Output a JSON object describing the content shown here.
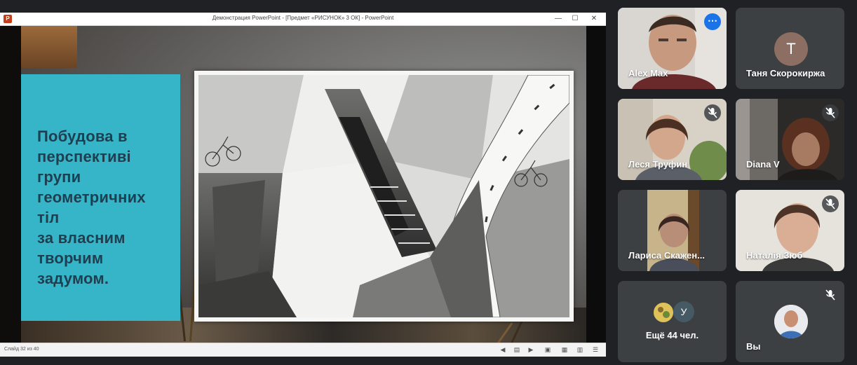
{
  "presentation": {
    "window_title": "Демонстрация PowerPoint - [Предмет «РИСУНОК» 3 ОК] - PowerPoint",
    "app_icon_letter": "P",
    "controls": {
      "minimize": "—",
      "maximize": "☐",
      "close": "✕"
    },
    "slide_text": "Побудова в\nперспективі\nгрупи\nгеометричних\nтіл\nза власним\nтворчим\nзадумом.",
    "status": {
      "slide_counter": "Слайд 32 из 40"
    }
  },
  "participants": [
    {
      "name": "Alex Max",
      "type": "video",
      "active": true,
      "more_icon": "⋯"
    },
    {
      "name": "Таня Скорокиржа",
      "type": "avatar",
      "initial": "Т",
      "avatar_color": "#8d6e63"
    },
    {
      "name": "Леся Труфин",
      "type": "video",
      "muted": true
    },
    {
      "name": "Diana V",
      "type": "video",
      "muted": true
    },
    {
      "name": "Лариса Скажен...",
      "type": "video",
      "muted": false
    },
    {
      "name": "Наталія Зюб",
      "type": "video",
      "muted": true
    }
  ],
  "others": {
    "label": "Ещё 44 чел.",
    "avatar_initial": "У"
  },
  "self": {
    "name": "Вы",
    "muted": true
  },
  "colors": {
    "accent": "#8ab4f8",
    "teal": "#36b5c8",
    "slide_text": "#1e3f50",
    "tile_bg": "#3c4043"
  }
}
